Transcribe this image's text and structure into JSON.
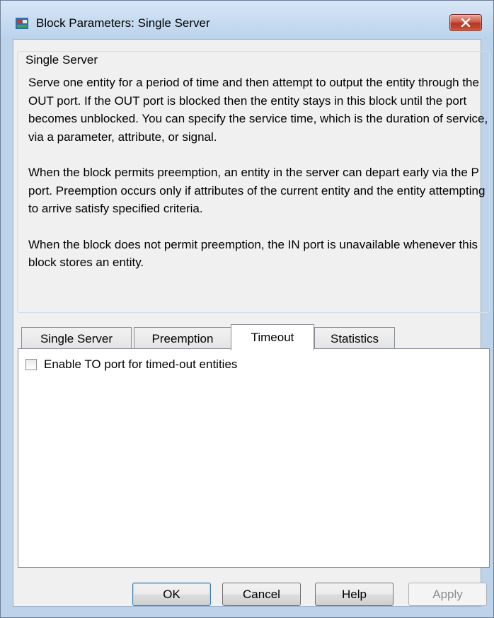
{
  "window": {
    "title": "Block Parameters: Single Server"
  },
  "group": {
    "legend": "Single Server",
    "paragraphs": [
      "Serve one entity for a period of time and then attempt to output the entity through the OUT port. If the OUT port is blocked then the entity stays in this block until the port becomes unblocked. You can specify the service time, which is the duration of service, via a parameter, attribute, or signal.",
      "When the block permits preemption, an entity in the server can depart early via the P port. Preemption occurs only if attributes of the current entity and the entity attempting to arrive satisfy specified criteria.",
      "When the block does not permit preemption, the IN port is unavailable whenever this block stores an entity."
    ]
  },
  "tabs": [
    {
      "label": "Single Server",
      "active": false
    },
    {
      "label": "Preemption",
      "active": false
    },
    {
      "label": "Timeout",
      "active": true
    },
    {
      "label": "Statistics",
      "active": false
    }
  ],
  "timeout_tab": {
    "enable_to_port": {
      "label": "Enable TO port for timed-out entities",
      "checked": false
    }
  },
  "buttons": {
    "ok": "OK",
    "cancel": "Cancel",
    "help": "Help",
    "apply": "Apply"
  },
  "icons": {
    "app": "simulink-block-icon",
    "close": "close-x-icon"
  }
}
